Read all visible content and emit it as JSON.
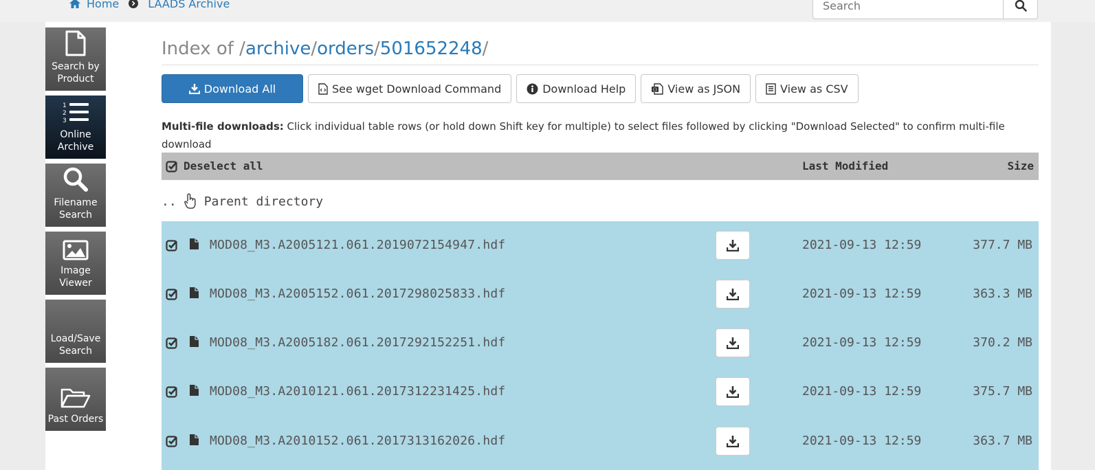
{
  "breadcrumb": {
    "home": "Home",
    "archive": "LAADS Archive"
  },
  "search": {
    "placeholder": "Search"
  },
  "sidebar": {
    "items": [
      {
        "label": "Search by Product",
        "icon": "file-icon"
      },
      {
        "label": "Online Archive",
        "icon": "list-icon",
        "active": true
      },
      {
        "label": "Filename Search",
        "icon": "search-icon"
      },
      {
        "label": "Image Viewer",
        "icon": "image-icon"
      },
      {
        "label": "Load/Save Search",
        "icon": ""
      },
      {
        "label": "Past Orders",
        "icon": "folder-open-icon"
      }
    ]
  },
  "title": {
    "prefix": "Index of",
    "path": [
      "archive",
      "orders",
      "501652248"
    ]
  },
  "buttons": {
    "download_all": "Download All",
    "wget": "See wget Download Command",
    "help": "Download Help",
    "json": "View as JSON",
    "csv": "View as CSV"
  },
  "info": {
    "bold": "Multi-file downloads:",
    "text": " Click individual table rows (or hold down Shift key for multiple) to select files followed by clicking \"Download Selected\" to confirm multi-file download"
  },
  "table": {
    "deselect_label": "Deselect all",
    "col_modified": "Last Modified",
    "col_size": "Size",
    "parent_dots": "..",
    "parent_label": "Parent directory",
    "rows": [
      {
        "name": "MOD08_M3.A2005121.061.2019072154947.hdf",
        "modified": "2021-09-13 12:59",
        "size": "377.7 MB"
      },
      {
        "name": "MOD08_M3.A2005152.061.2017298025833.hdf",
        "modified": "2021-09-13 12:59",
        "size": "363.3 MB"
      },
      {
        "name": "MOD08_M3.A2005182.061.2017292152251.hdf",
        "modified": "2021-09-13 12:59",
        "size": "370.2 MB"
      },
      {
        "name": "MOD08_M3.A2010121.061.2017312231425.hdf",
        "modified": "2021-09-13 12:59",
        "size": "375.7 MB"
      },
      {
        "name": "MOD08_M3.A2010152.061.2017313162026.hdf",
        "modified": "2021-09-13 12:59",
        "size": "363.7 MB"
      }
    ]
  },
  "colors": {
    "accent": "#2f78b9",
    "row_selected": "#add8e6",
    "header_gray": "#bdbdbd",
    "nav_dark": "#0c141d"
  }
}
